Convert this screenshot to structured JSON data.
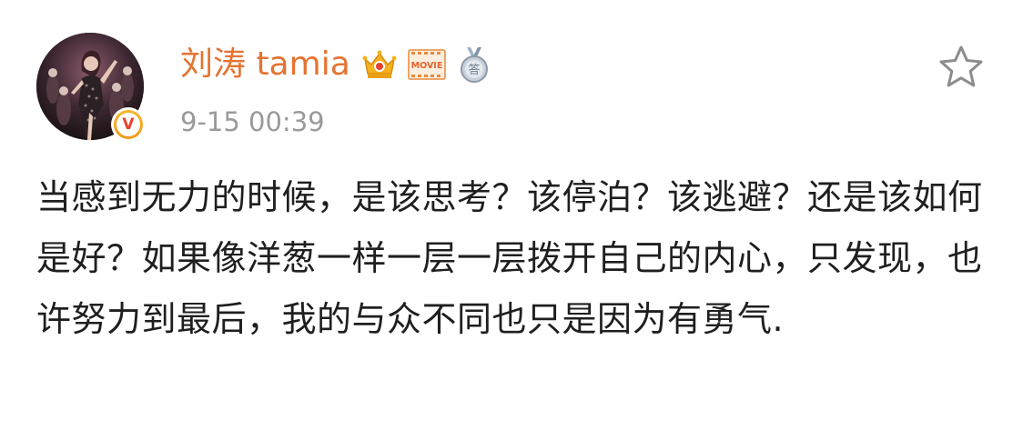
{
  "post": {
    "author": {
      "name": "刘涛 tamia",
      "verified_mark": "V",
      "badges": [
        "crown-icon",
        "movie-icon",
        "medal-icon"
      ],
      "badge_text": {
        "movie": "MOVIE",
        "medal": "答"
      }
    },
    "timestamp": "9-15 00:39",
    "text": "当感到无力的时候，是该思考？该停泊？该逃避？还是该如何是好？如果像洋葱一样一层一层拨开自己的内心，只发现，也许努力到最后，我的与众不同也只是因为有勇气.",
    "favorite_icon": "star-outline-icon"
  },
  "colors": {
    "username": "#e57332",
    "timestamp": "#9a9a9a",
    "text": "#1f1f1f",
    "verified": "#f29b1a",
    "verified_v": "#e5412d",
    "star_stroke": "#8c8c8c"
  }
}
